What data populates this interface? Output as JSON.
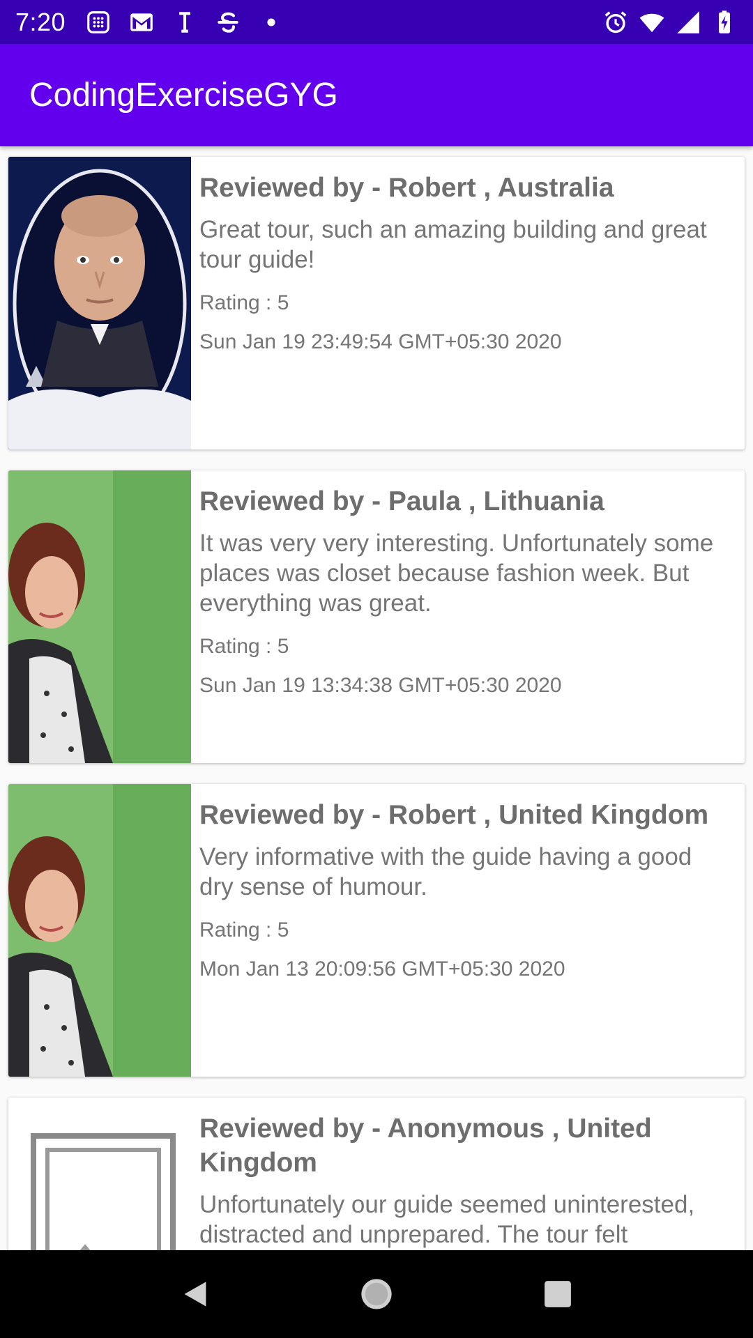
{
  "status_bar": {
    "time": "7:20",
    "left_icons": [
      "calculator-icon",
      "gmail-icon",
      "text-icon",
      "strikethrough-app-icon",
      "dot-icon"
    ],
    "right_icons": [
      "alarm-icon",
      "wifi-icon",
      "signal-icon",
      "battery-charging-icon"
    ],
    "bg_color": "#3700b3"
  },
  "app_bar": {
    "title": "CodingExerciseGYG",
    "bg_color": "#6200ee"
  },
  "reviews": [
    {
      "reviewer": "Reviewed by - Robert , Australia",
      "message": "Great tour, such an amazing building and great tour guide!",
      "rating": "Rating : 5",
      "date": "Sun Jan 19 23:49:54 GMT+05:30 2020",
      "photo": "man-portrait"
    },
    {
      "reviewer": "Reviewed by - Paula , Lithuania",
      "message": "It was very very interesting. Unfortunately some places was closet because fashion week. But everything was great.",
      "rating": "Rating : 5",
      "date": "Sun Jan 19 13:34:38 GMT+05:30 2020",
      "photo": "woman-portrait"
    },
    {
      "reviewer": "Reviewed by - Robert , United Kingdom",
      "message": "Very informative with the guide having a good dry sense of humour.",
      "rating": "Rating : 5",
      "date": "Mon Jan 13 20:09:56 GMT+05:30 2020",
      "photo": "woman-portrait"
    },
    {
      "reviewer": "Reviewed by - Anonymous , United Kingdom",
      "message": "Unfortunately our guide seemed uninterested, distracted and unprepared. The tour felt",
      "photo": "placeholder-image"
    }
  ],
  "nav_bar": {
    "buttons": [
      "back-icon",
      "home-icon",
      "recents-icon"
    ]
  }
}
